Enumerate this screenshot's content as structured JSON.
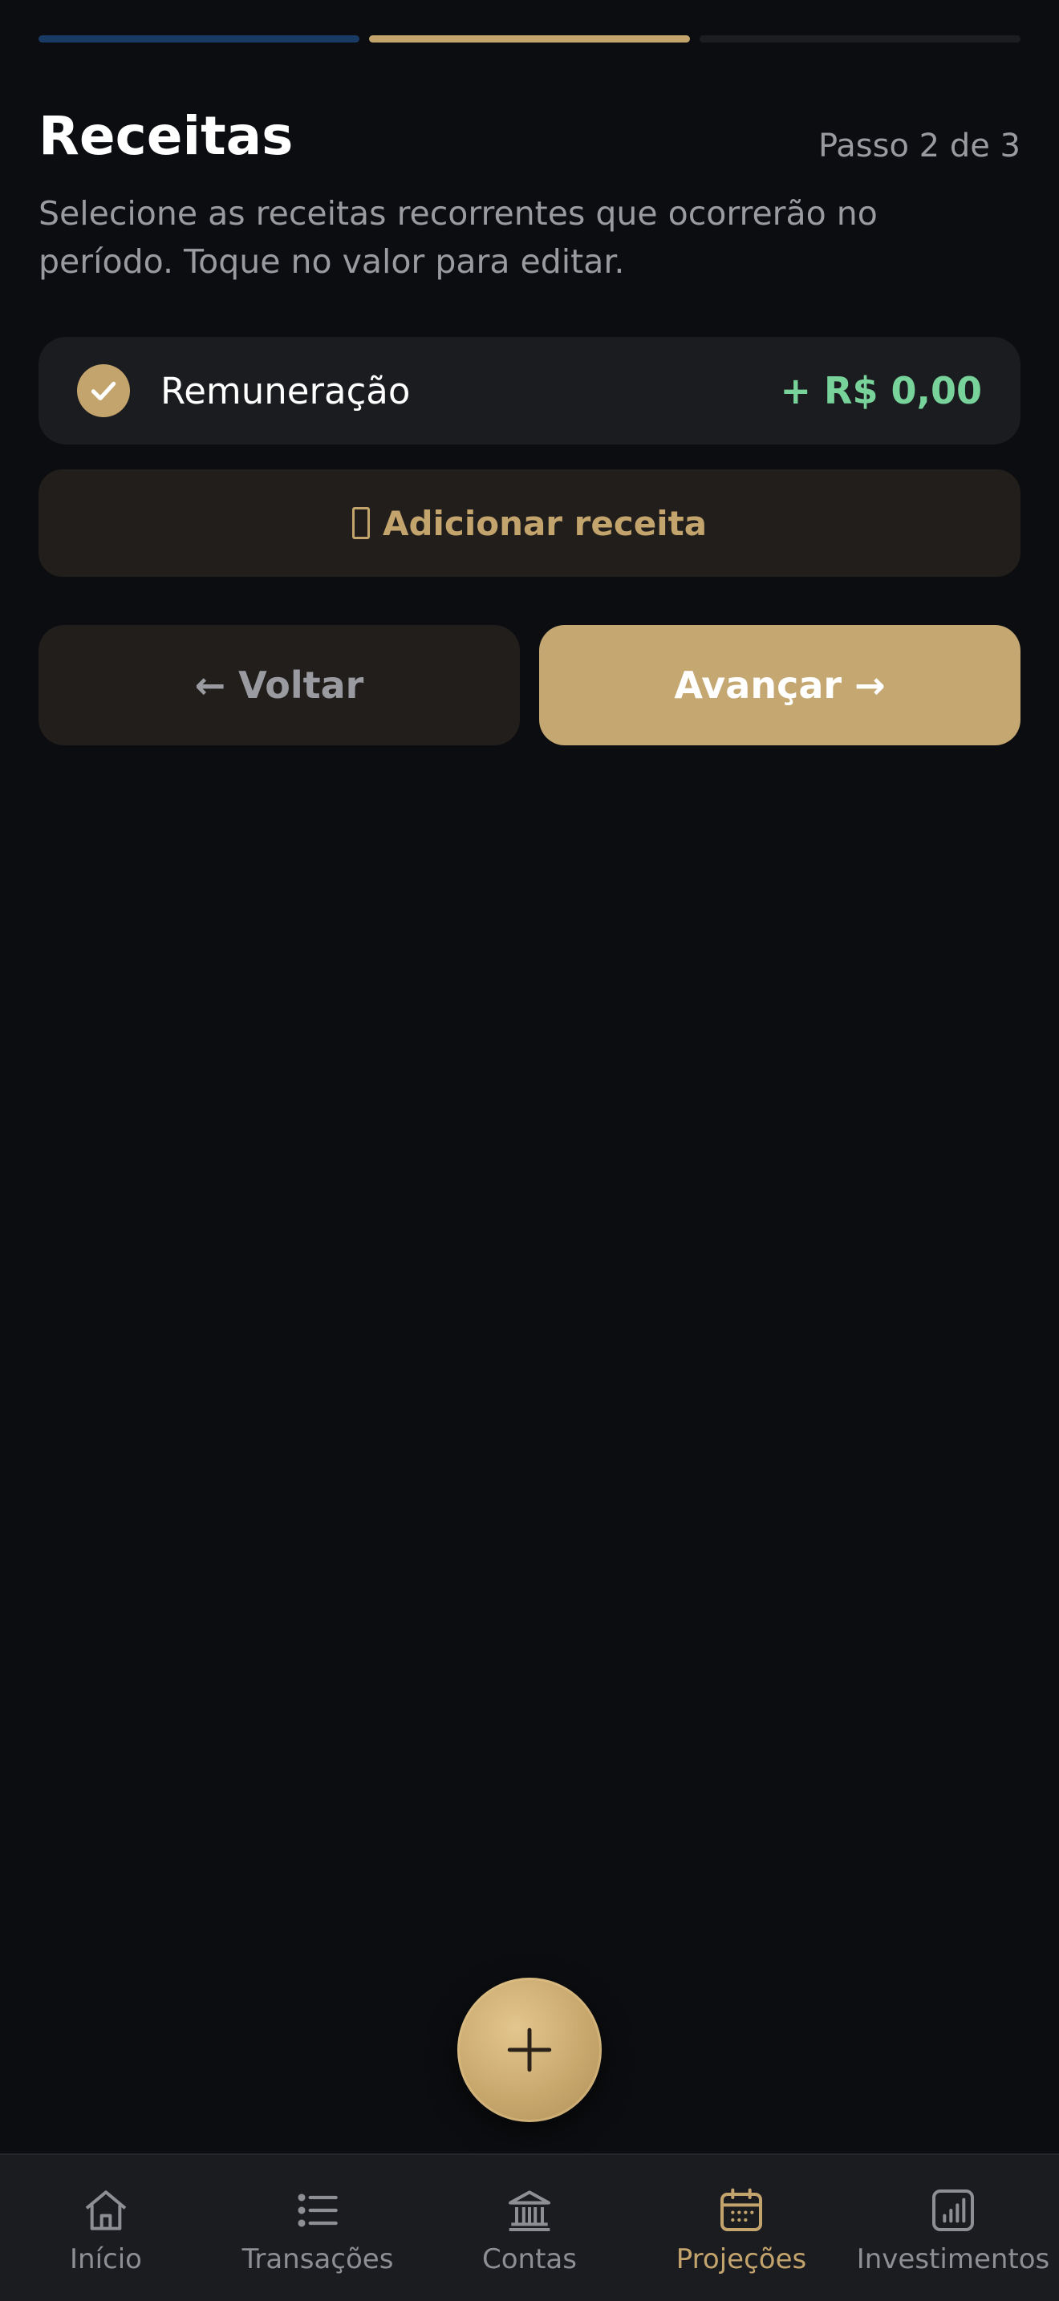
{
  "progress": {
    "steps": [
      {
        "state": "done",
        "color": "#1a3a66"
      },
      {
        "state": "current",
        "color": "#c4a46d"
      },
      {
        "state": "pending",
        "color": "#1c1d21"
      }
    ]
  },
  "header": {
    "title": "Receitas",
    "step_label": "Passo 2 de 3",
    "subtitle": "Selecione as receitas recorrentes que ocorrerão no período. Toque no valor para editar."
  },
  "income_items": [
    {
      "name": "Remuneração",
      "value": "+ R$ 0,00",
      "checked": true,
      "icon": "check-icon"
    }
  ],
  "add_button": {
    "label": "Adicionar receita",
    "icon": "missing-glyph-icon"
  },
  "actions": {
    "back_label": "← Voltar",
    "next_label": "Avançar →"
  },
  "fab": {
    "icon": "plus-icon"
  },
  "bottom_nav": {
    "items": [
      {
        "label": "Início",
        "icon": "home-icon",
        "active": false
      },
      {
        "label": "Transações",
        "icon": "list-icon",
        "active": false
      },
      {
        "label": "Contas",
        "icon": "bank-icon",
        "active": false
      },
      {
        "label": "Projeções",
        "icon": "calendar-icon",
        "active": true
      },
      {
        "label": "Investimentos",
        "icon": "chart-icon",
        "active": false
      }
    ]
  },
  "colors": {
    "background": "#0c0d10",
    "card": "#1b1c20",
    "accent_gold": "#c4a46d",
    "positive_green": "#78d39a",
    "muted_text": "#9a9ba1"
  }
}
